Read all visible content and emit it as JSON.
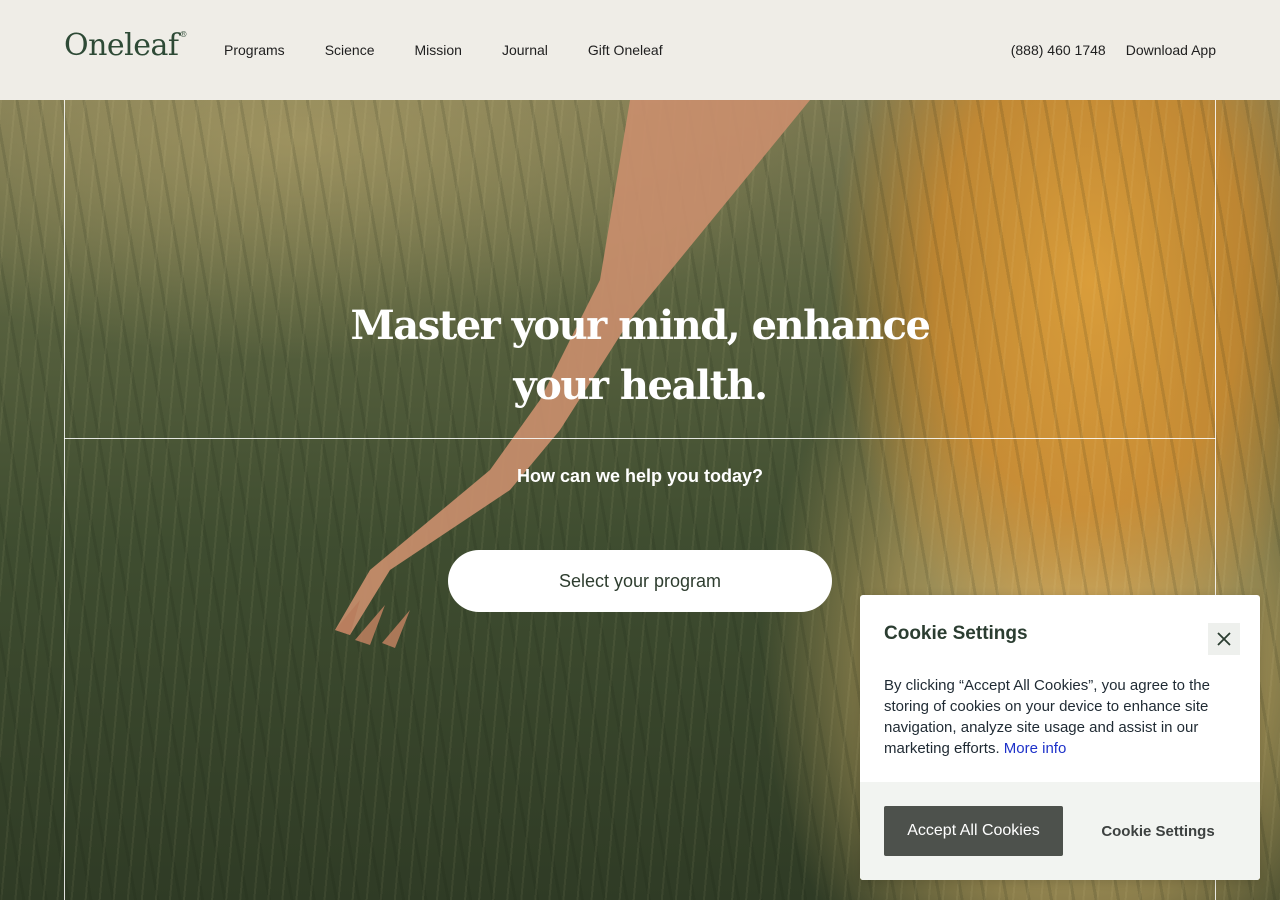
{
  "header": {
    "logo_text": "Oneleaf",
    "logo_mark": "®",
    "nav": [
      "Programs",
      "Science",
      "Mission",
      "Journal",
      "Gift Oneleaf"
    ],
    "phone": "(888) 460 1748",
    "download": "Download App"
  },
  "hero": {
    "headline_line1": "Master your mind, enhance",
    "headline_line2": "your health.",
    "subheading": "How can we help you today?",
    "cta": "Select your program"
  },
  "cookie": {
    "title": "Cookie Settings",
    "body": "By clicking “Accept All Cookies”, you agree to the storing of cookies on your device to enhance site navigation, analyze site usage and assist in our marketing efforts.",
    "more_info": "More info",
    "accept": "Accept All Cookies",
    "settings": "Cookie Settings"
  },
  "colors": {
    "header_bg": "#efede7",
    "brand_green": "#2e4a36",
    "accept_button": "#4d514c",
    "link_blue": "#1d31c9"
  },
  "icons": {
    "close": "close-icon"
  }
}
